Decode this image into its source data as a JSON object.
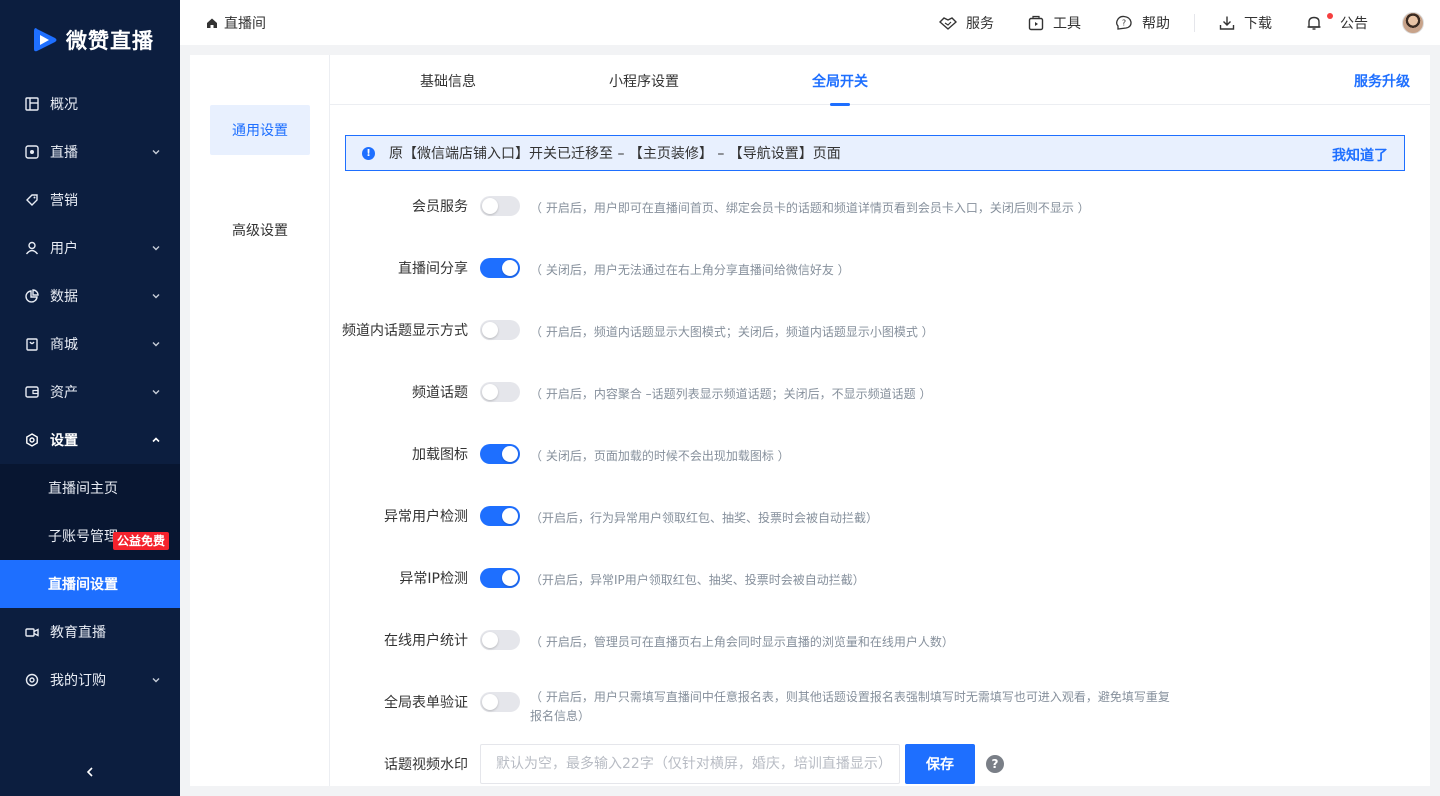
{
  "brand": {
    "name": "微赞直播",
    "accent": "#1e6fff",
    "sidebar_bg": "#0c1e3f"
  },
  "sidebar": {
    "items": [
      {
        "label": "概况",
        "icon": "overview-icon",
        "chevron": false
      },
      {
        "label": "直播",
        "icon": "live-icon",
        "chevron": true
      },
      {
        "label": "营销",
        "icon": "tag-icon",
        "chevron": false
      },
      {
        "label": "用户",
        "icon": "user-icon",
        "chevron": true
      },
      {
        "label": "数据",
        "icon": "pie-chart-icon",
        "chevron": true
      },
      {
        "label": "商城",
        "icon": "shop-icon",
        "chevron": true
      },
      {
        "label": "资产",
        "icon": "wallet-icon",
        "chevron": true
      },
      {
        "label": "设置",
        "icon": "settings-icon",
        "chevron": true
      }
    ],
    "settings_sub": [
      {
        "label": "直播间主页"
      },
      {
        "label": "子账号管理"
      },
      {
        "label": "直播间设置"
      }
    ],
    "extra": [
      {
        "label": "教育直播",
        "icon": "camera-icon"
      },
      {
        "label": "我的订购",
        "icon": "order-icon"
      }
    ],
    "badge": "公益免费"
  },
  "topbar": {
    "breadcrumb": "直播间",
    "actions": [
      {
        "label": "服务",
        "icon": "handshake-icon"
      },
      {
        "label": "工具",
        "icon": "toolbox-icon"
      },
      {
        "label": "帮助",
        "icon": "help-icon"
      },
      {
        "label": "下载",
        "icon": "download-icon"
      },
      {
        "label": "公告",
        "icon": "bell-icon"
      }
    ]
  },
  "leftnav": {
    "items": [
      "通用设置",
      "高级设置"
    ]
  },
  "tabs": {
    "items": [
      "基础信息",
      "小程序设置",
      "全局开关"
    ],
    "active": "全局开关",
    "upgrade": "服务升级"
  },
  "alert": {
    "text": "原【微信端店铺入口】开关已迁移至 – 【主页装修】 – 【导航设置】页面",
    "action": "我知道了"
  },
  "settings": [
    {
      "label": "会员服务",
      "on": false,
      "desc": "（ 开启后，用户即可在直播间首页、绑定会员卡的话题和频道详情页看到会员卡入口，关闭后则不显示 ）"
    },
    {
      "label": "直播间分享",
      "on": true,
      "desc": "（ 关闭后，用户无法通过在右上角分享直播间给微信好友 ）"
    },
    {
      "label": "频道内话题显示方式",
      "on": false,
      "desc": "（ 开启后，频道内话题显示大图模式；关闭后，频道内话题显示小图模式 ）"
    },
    {
      "label": "频道话题",
      "on": false,
      "desc": "（ 开启后，内容聚合 –话题列表显示频道话题；关闭后，不显示频道话题 ）"
    },
    {
      "label": "加载图标",
      "on": true,
      "desc": "（ 关闭后，页面加载的时候不会出现加载图标 ）"
    },
    {
      "label": "异常用户检测",
      "on": true,
      "desc": "（开启后，行为异常用户领取红包、抽奖、投票时会被自动拦截）"
    },
    {
      "label": "异常IP检测",
      "on": true,
      "desc": "（开启后，异常IP用户领取红包、抽奖、投票时会被自动拦截）"
    },
    {
      "label": "在线用户统计",
      "on": false,
      "desc": "（ 开启后，管理员可在直播页右上角会同时显示直播的浏览量和在线用户人数）"
    },
    {
      "label": "全局表单验证",
      "on": false,
      "desc": "（ 开启后，用户只需填写直播间中任意报名表，则其他话题设置报名表强制填写时无需填写也可进入观看，避免填写重复报名信息）"
    }
  ],
  "watermark": {
    "label": "话题视频水印",
    "placeholder": "默认为空，最多输入22字（仅针对横屏，婚庆，培训直播显示）",
    "value": "",
    "save": "保存",
    "help": "?"
  }
}
